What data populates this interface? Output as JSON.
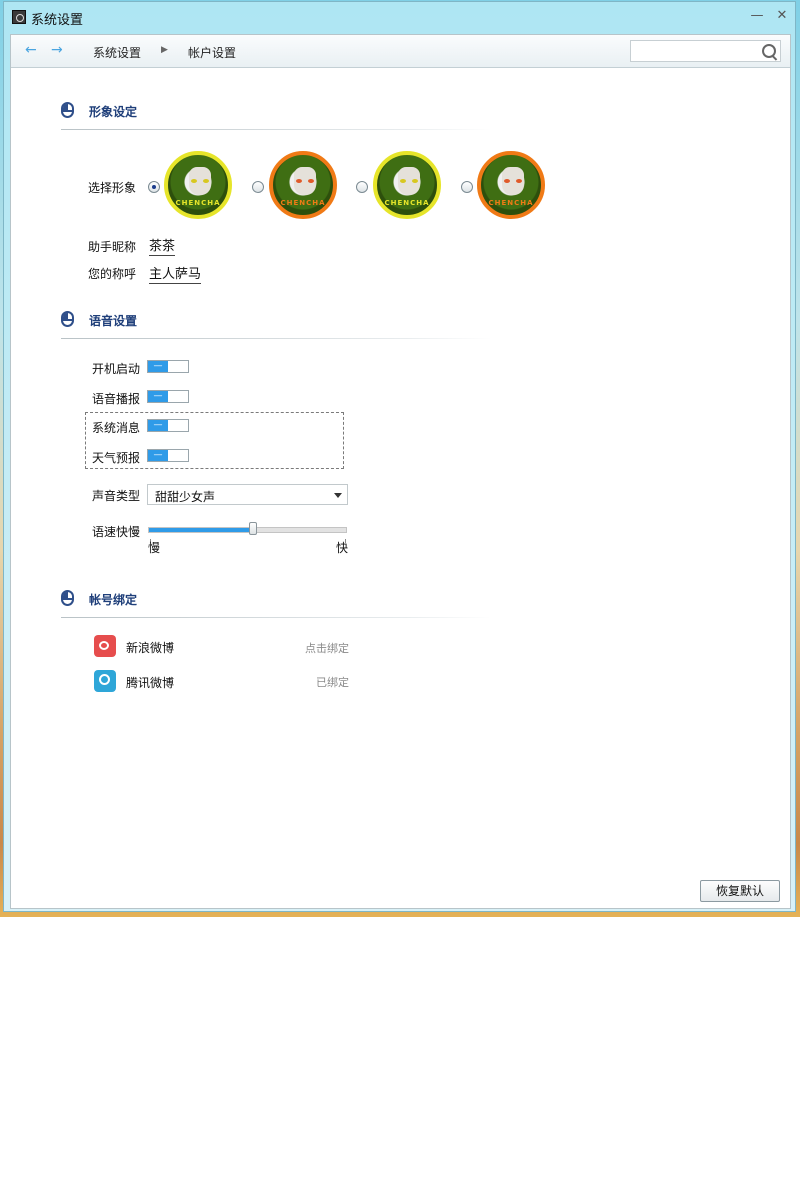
{
  "window": {
    "title": "系统设置",
    "minimize_glyph": "—",
    "close_glyph": "✕"
  },
  "nav": {
    "back_icon": "←",
    "forward_icon": "→",
    "breadcrumb": [
      "系统设置",
      "帐户设置"
    ],
    "separator": "▶",
    "search_placeholder": ""
  },
  "sections": {
    "avatar": {
      "title": "形象设定",
      "select_label": "选择形象",
      "avatars": [
        {
          "variant": "yellow",
          "brand": "CHENCHA",
          "selected": true
        },
        {
          "variant": "orange",
          "brand": "CHENCHA",
          "selected": false
        },
        {
          "variant": "yellow",
          "brand": "CHENCHA",
          "selected": false
        },
        {
          "variant": "orange",
          "brand": "CHENCHA",
          "selected": false
        }
      ],
      "nickname_label": "助手昵称",
      "nickname_value": "茶茶",
      "callname_label": "您的称呼",
      "callname_value": "主人萨马"
    },
    "voice": {
      "title": "语音设置",
      "toggles": [
        {
          "label": "开机启动",
          "state": "on"
        },
        {
          "label": "语音播报",
          "state": "on"
        },
        {
          "label": "系统消息",
          "state": "on"
        },
        {
          "label": "天气预报",
          "state": "on"
        }
      ],
      "toggle_glyph": "—",
      "voice_type_label": "声音类型",
      "voice_type_value": "甜甜少女声",
      "speed_label": "语速快慢",
      "speed_level": 0.53,
      "speed_min_label": "慢",
      "speed_max_label": "快"
    },
    "accounts": {
      "title": "帐号绑定",
      "items": [
        {
          "name": "新浪微博",
          "icon": "weibo-icon",
          "status": "点击绑定"
        },
        {
          "name": "腾讯微博",
          "icon": "tencent-weibo-icon",
          "status": "已绑定"
        }
      ]
    }
  },
  "footer": {
    "restore_label": "恢复默认"
  },
  "colors": {
    "accent": "#2f9be8",
    "section_title": "#1f3f7a",
    "avatar_yellow": "#e6e52a",
    "avatar_orange": "#f07a16"
  }
}
